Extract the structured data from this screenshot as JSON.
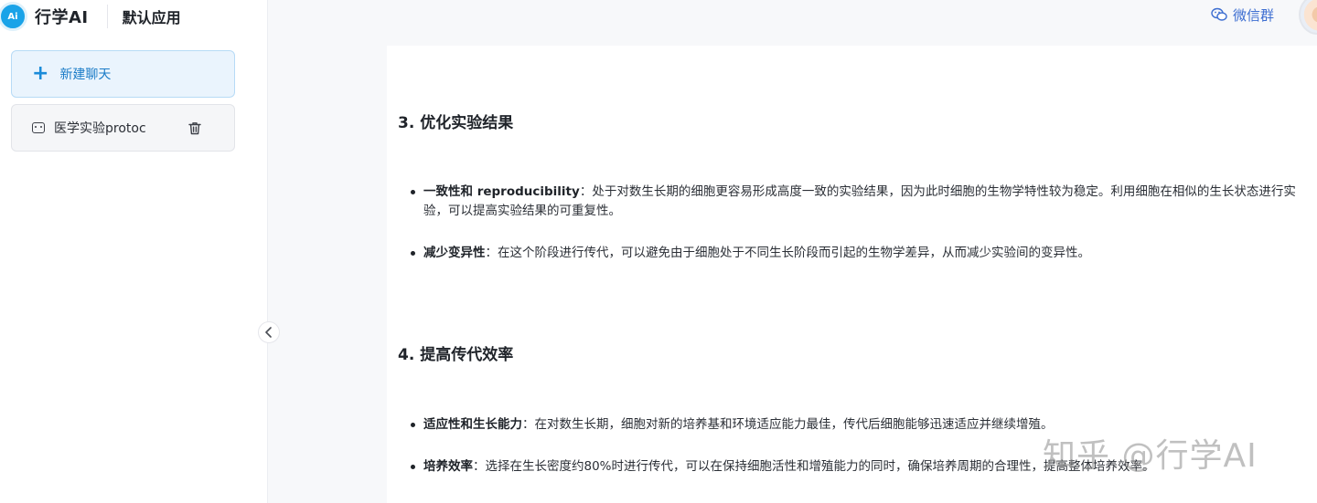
{
  "header": {
    "logo_text": "Ai",
    "brand": "行学AI",
    "app_name": "默认应用",
    "wechat_label": "微信群"
  },
  "sidebar": {
    "new_chat_label": "新建聊天",
    "chats": [
      {
        "label": "医学实验protoc"
      }
    ]
  },
  "main": {
    "sections": [
      {
        "heading": "3. 优化实验结果",
        "bullets": [
          {
            "term": "一致性和 reproducibility",
            "text": "：处于对数生长期的细胞更容易形成高度一致的实验结果，因为此时细胞的生物学特性较为稳定。利用细胞在相似的生长状态进行实验，可以提高实验结果的可重复性。"
          },
          {
            "term": "减少变异性",
            "text": "：在这个阶段进行传代，可以避免由于细胞处于不同生长阶段而引起的生物学差异，从而减少实验间的变异性。"
          }
        ]
      },
      {
        "heading": "4. 提高传代效率",
        "bullets": [
          {
            "term": "适应性和生长能力",
            "text": "：在对数生长期，细胞对新的培养基和环境适应能力最佳，传代后细胞能够迅速适应并继续增殖。"
          },
          {
            "term": "培养效率",
            "text": "：选择在生长密度约80%时进行传代，可以在保持细胞活性和增殖能力的同时，确保培养周期的合理性，提高整体培养效率。"
          }
        ]
      }
    ]
  },
  "watermark": "知乎 @行学AI",
  "colors": {
    "accent": "#1a8bd9",
    "link": "#3d6ed1",
    "new_chat_bg": "#eaf4fd"
  }
}
